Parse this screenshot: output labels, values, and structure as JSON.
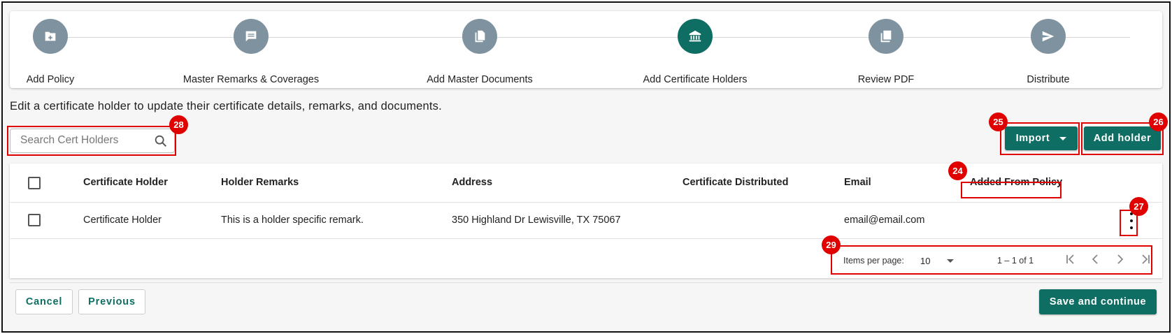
{
  "stepper": {
    "steps": [
      {
        "label": "Add Policy",
        "icon": "folder-add-icon",
        "active": false
      },
      {
        "label": "Master Remarks & Coverages",
        "icon": "comment-icon",
        "active": false
      },
      {
        "label": "Add Master Documents",
        "icon": "documents-icon",
        "active": false
      },
      {
        "label": "Add Certificate Holders",
        "icon": "bank-icon",
        "active": true
      },
      {
        "label": "Review PDF",
        "icon": "pdf-icon",
        "active": false
      },
      {
        "label": "Distribute",
        "icon": "send-icon",
        "active": false
      }
    ]
  },
  "description": "Edit a certificate holder to update their certificate details, remarks, and documents.",
  "search": {
    "placeholder": "Search Cert Holders",
    "value": ""
  },
  "toolbar": {
    "import_label": "Import",
    "add_holder_label": "Add holder"
  },
  "table": {
    "columns": [
      "Certificate Holder",
      "Holder Remarks",
      "Address",
      "Certificate Distributed",
      "Email",
      "Added From Policy"
    ],
    "rows": [
      {
        "holder": "Certificate Holder",
        "remarks": "This is a holder specific remark.",
        "address": "350 Highland Dr Lewisville, TX 75067",
        "distributed": "",
        "email": "email@email.com",
        "added_from_policy": ""
      }
    ]
  },
  "paginator": {
    "items_per_page_label": "Items per page:",
    "page_size": "10",
    "range": "1 – 1 of 1"
  },
  "footer": {
    "cancel_label": "Cancel",
    "previous_label": "Previous",
    "save_label": "Save and continue"
  },
  "annotations": [
    "24",
    "25",
    "26",
    "27",
    "28",
    "29"
  ],
  "colors": {
    "primary": "#0f6e63",
    "step_inactive": "#7e939f",
    "annotation": "#e00000"
  }
}
